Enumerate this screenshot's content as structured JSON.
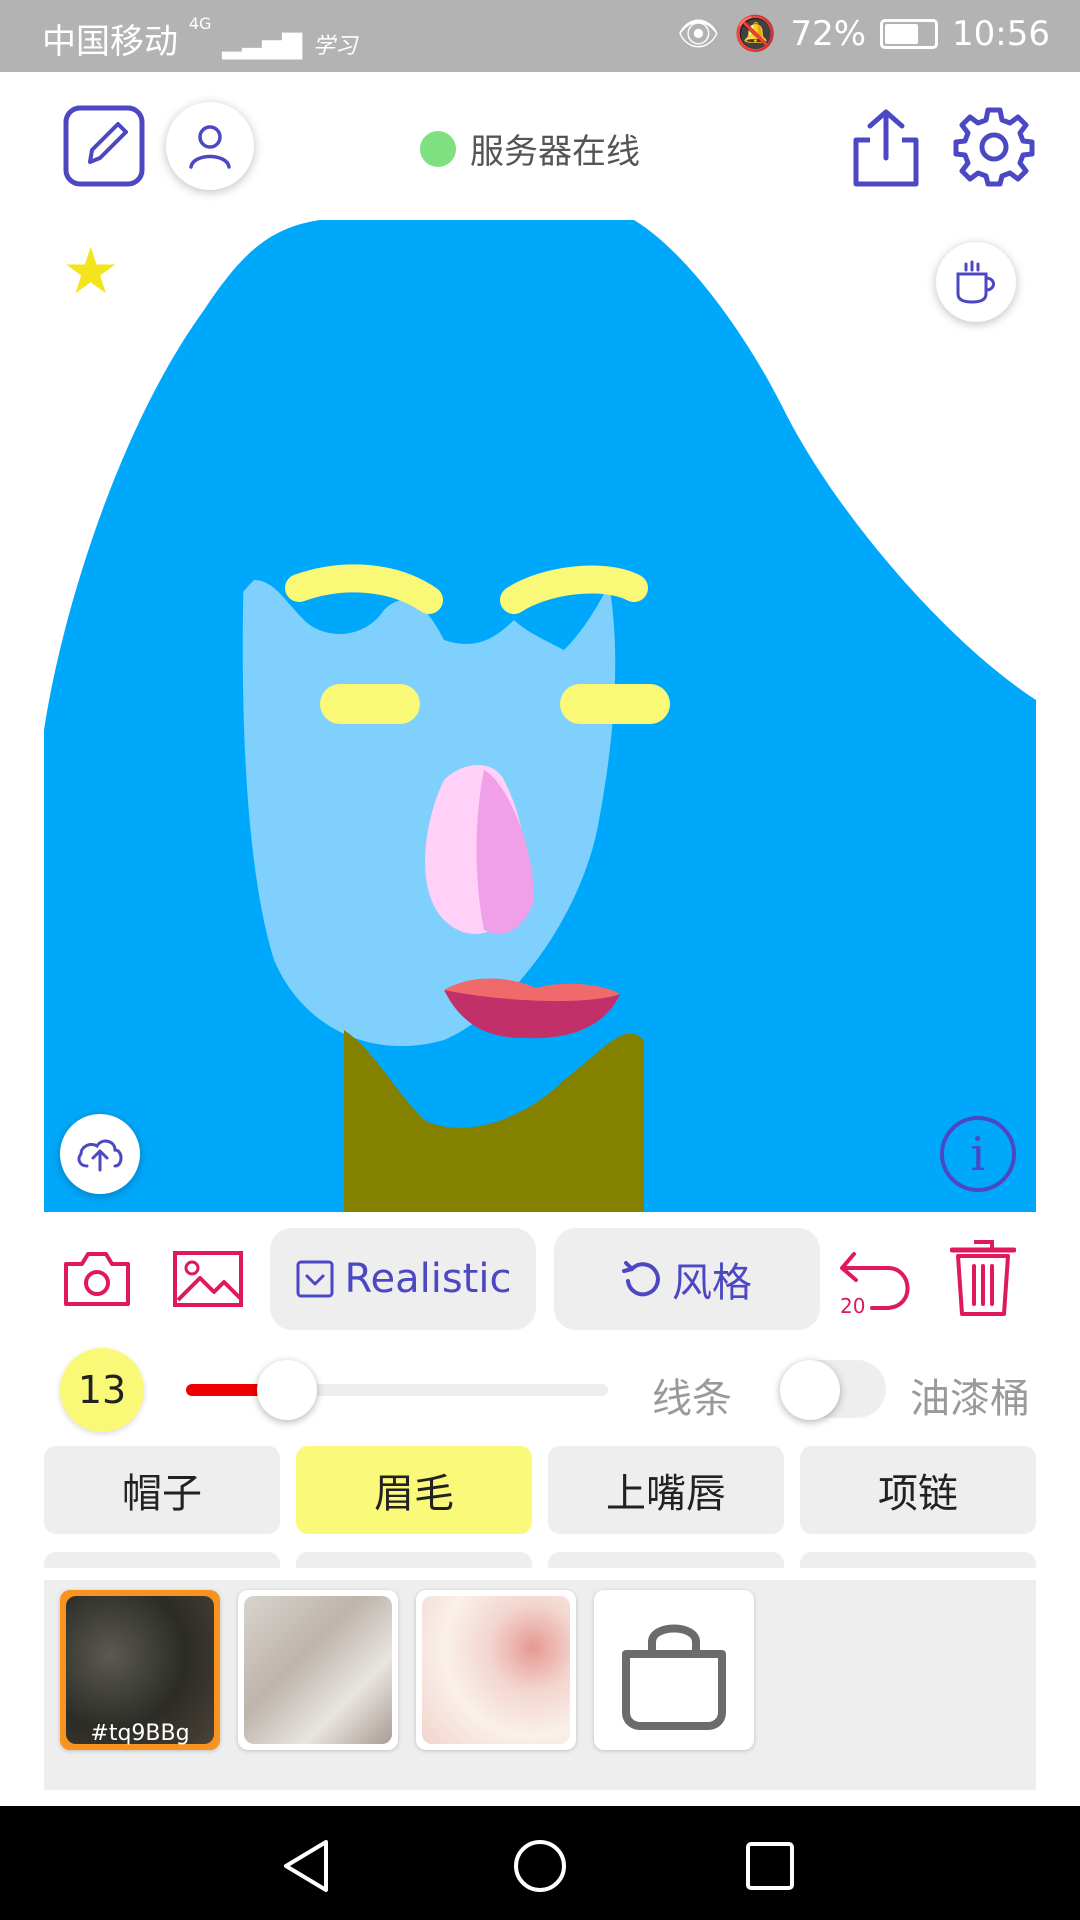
{
  "status_bar": {
    "carrier": "中国移动",
    "network": "4G",
    "extra_label": "学习",
    "battery": "72%",
    "time": "10:56"
  },
  "header": {
    "server_status": "服务器在线",
    "server_status_color": "#7ee07e"
  },
  "toolbar": {
    "style_mode_label": "Realistic",
    "style_button_label": "风格",
    "undo_count": "20"
  },
  "brush": {
    "size": "13",
    "size_fraction": 0.24,
    "line_label": "线条",
    "bucket_label": "油漆桶",
    "bucket_enabled": false
  },
  "categories": [
    {
      "label": "帽子",
      "active": false
    },
    {
      "label": "眉毛",
      "active": true
    },
    {
      "label": "上嘴唇",
      "active": false
    },
    {
      "label": "项链",
      "active": false
    }
  ],
  "textures": [
    {
      "label": "#tq9BBg",
      "selected": true
    },
    {
      "label": "",
      "selected": false
    },
    {
      "label": "",
      "selected": false
    }
  ],
  "colors": {
    "accent": "#4c47c2",
    "danger": "#e0195a",
    "hair": "#00a8fb",
    "skin": "#7fd0fc",
    "eyebrow": "#faf977",
    "neck": "#848000",
    "selected_texture": "#f7931e"
  }
}
